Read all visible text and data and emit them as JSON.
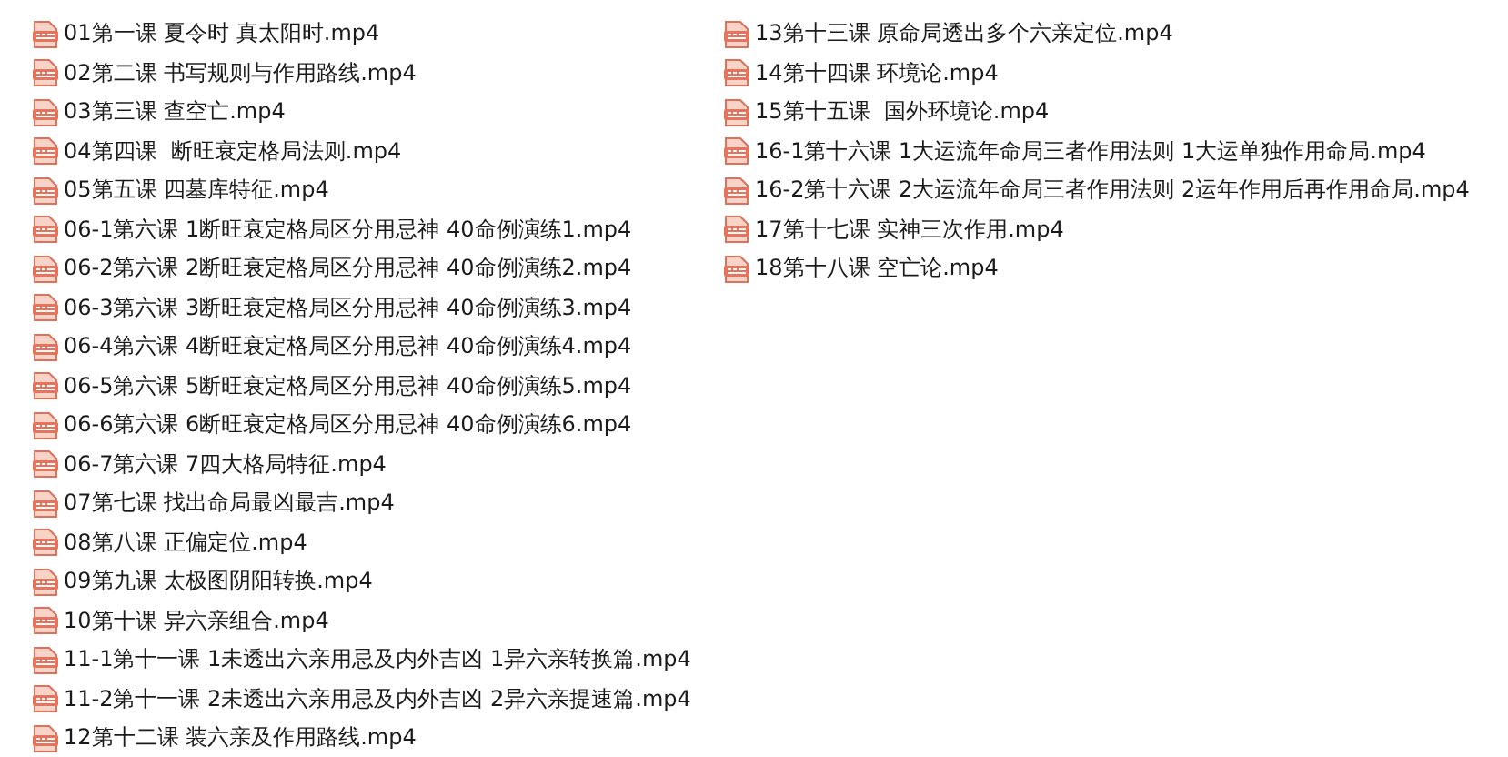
{
  "files": [
    {
      "name": "01第一课 夏令时 真太阳时.mp4"
    },
    {
      "name": "02第二课 书写规则与作用路线.mp4"
    },
    {
      "name": "03第三课 查空亡.mp4"
    },
    {
      "name": "04第四课  断旺衰定格局法则.mp4"
    },
    {
      "name": "05第五课 四墓库特征.mp4"
    },
    {
      "name": "06-1第六课 1断旺衰定格局区分用忌神 40命例演练1.mp4"
    },
    {
      "name": "06-2第六课 2断旺衰定格局区分用忌神 40命例演练2.mp4"
    },
    {
      "name": "06-3第六课 3断旺衰定格局区分用忌神 40命例演练3.mp4"
    },
    {
      "name": "06-4第六课 4断旺衰定格局区分用忌神 40命例演练4.mp4"
    },
    {
      "name": "06-5第六课 5断旺衰定格局区分用忌神 40命例演练5.mp4"
    },
    {
      "name": "06-6第六课 6断旺衰定格局区分用忌神 40命例演练6.mp4"
    },
    {
      "name": "06-7第六课 7四大格局特征.mp4"
    },
    {
      "name": "07第七课 找出命局最凶最吉.mp4"
    },
    {
      "name": "08第八课 正偏定位.mp4"
    },
    {
      "name": "09第九课 太极图阴阳转换.mp4"
    },
    {
      "name": "10第十课 异六亲组合.mp4"
    },
    {
      "name": "11-1第十一课 1未透出六亲用忌及内外吉凶 1异六亲转换篇.mp4"
    },
    {
      "name": "11-2第十一课 2未透出六亲用忌及内外吉凶 2异六亲提速篇.mp4"
    },
    {
      "name": "12第十二课 装六亲及作用路线.mp4"
    },
    {
      "name": "13第十三课 原命局透出多个六亲定位.mp4"
    },
    {
      "name": "14第十四课 环境论.mp4"
    },
    {
      "name": "15第十五课  国外环境论.mp4"
    },
    {
      "name": "16-1第十六课 1大运流年命局三者作用法则 1大运单独作用命局.mp4"
    },
    {
      "name": "16-2第十六课 2大运流年命局三者作用法则 2运年作用后再作用命局.mp4"
    },
    {
      "name": "17第十七课 实神三次作用.mp4"
    },
    {
      "name": "18第十八课 空亡论.mp4"
    }
  ]
}
